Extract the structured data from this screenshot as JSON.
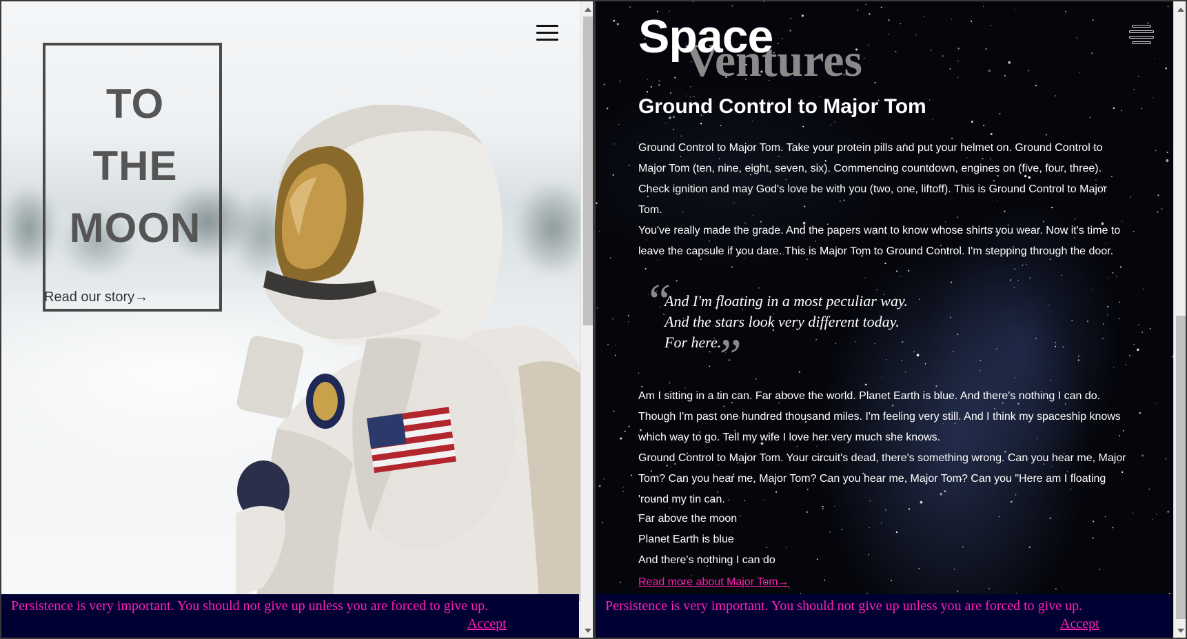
{
  "left": {
    "title_lines": [
      "TO",
      "THE",
      "MOON"
    ],
    "cta": "Read our story→",
    "menu_icon": "hamburger-icon",
    "banner": {
      "message": "Persistence is very important. You should not give up unless you are forced to give up.",
      "accept": "Accept"
    }
  },
  "right": {
    "logo": {
      "word1": "Space",
      "word2": "Ventures"
    },
    "menu_icon": "hamburger-icon",
    "heading": "Ground Control to Major Tom",
    "paragraphs": [
      "Ground Control to Major Tom. Take your protein pills and put your helmet on. Ground Control to Major Tom (ten, nine, eight, seven, six). Commencing countdown, engines on (five, four, three). Check ignition and may God's love be with you (two, one, liftoff). This is Ground Control to Major Tom.",
      "You've really made the grade. And the papers want to know whose shirts you wear. Now it's time to leave the capsule if you dare. This is Major Tom to Ground Control. I'm stepping through the door."
    ],
    "quote": {
      "open_mark": "“",
      "close_mark": "”",
      "lines": [
        "And I'm floating in a most peculiar way.",
        "And the stars look very different today.",
        "For here."
      ]
    },
    "paragraphs2": [
      "Am I sitting in a tin can. Far above the world. Planet Earth is blue. And there's nothing I can do. Though I'm past one hundred thousand miles. I'm feeling very still. And I think my spaceship  knows which way to go. Tell my wife I love her very much she knows.",
      "Ground Control to Major Tom. Your circuit's dead, there's something wrong. Can you hear me, Major Tom? Can you hear me, Major Tom? Can you hear me, Major Tom? Can you \"Here am I floating 'round my tin can."
    ],
    "short_lines": [
      "Far above the moon",
      "Planet Earth is blue",
      "And there's nothing I can do"
    ],
    "read_more": "Read more about Major Tom→",
    "banner": {
      "message": "Persistence is very important. You should not give up unless you are forced to give up.",
      "accept": "Accept"
    }
  },
  "colors": {
    "accent_pink": "#ff1fb3",
    "banner_bg": "#000033",
    "title_gray": "#555555"
  }
}
